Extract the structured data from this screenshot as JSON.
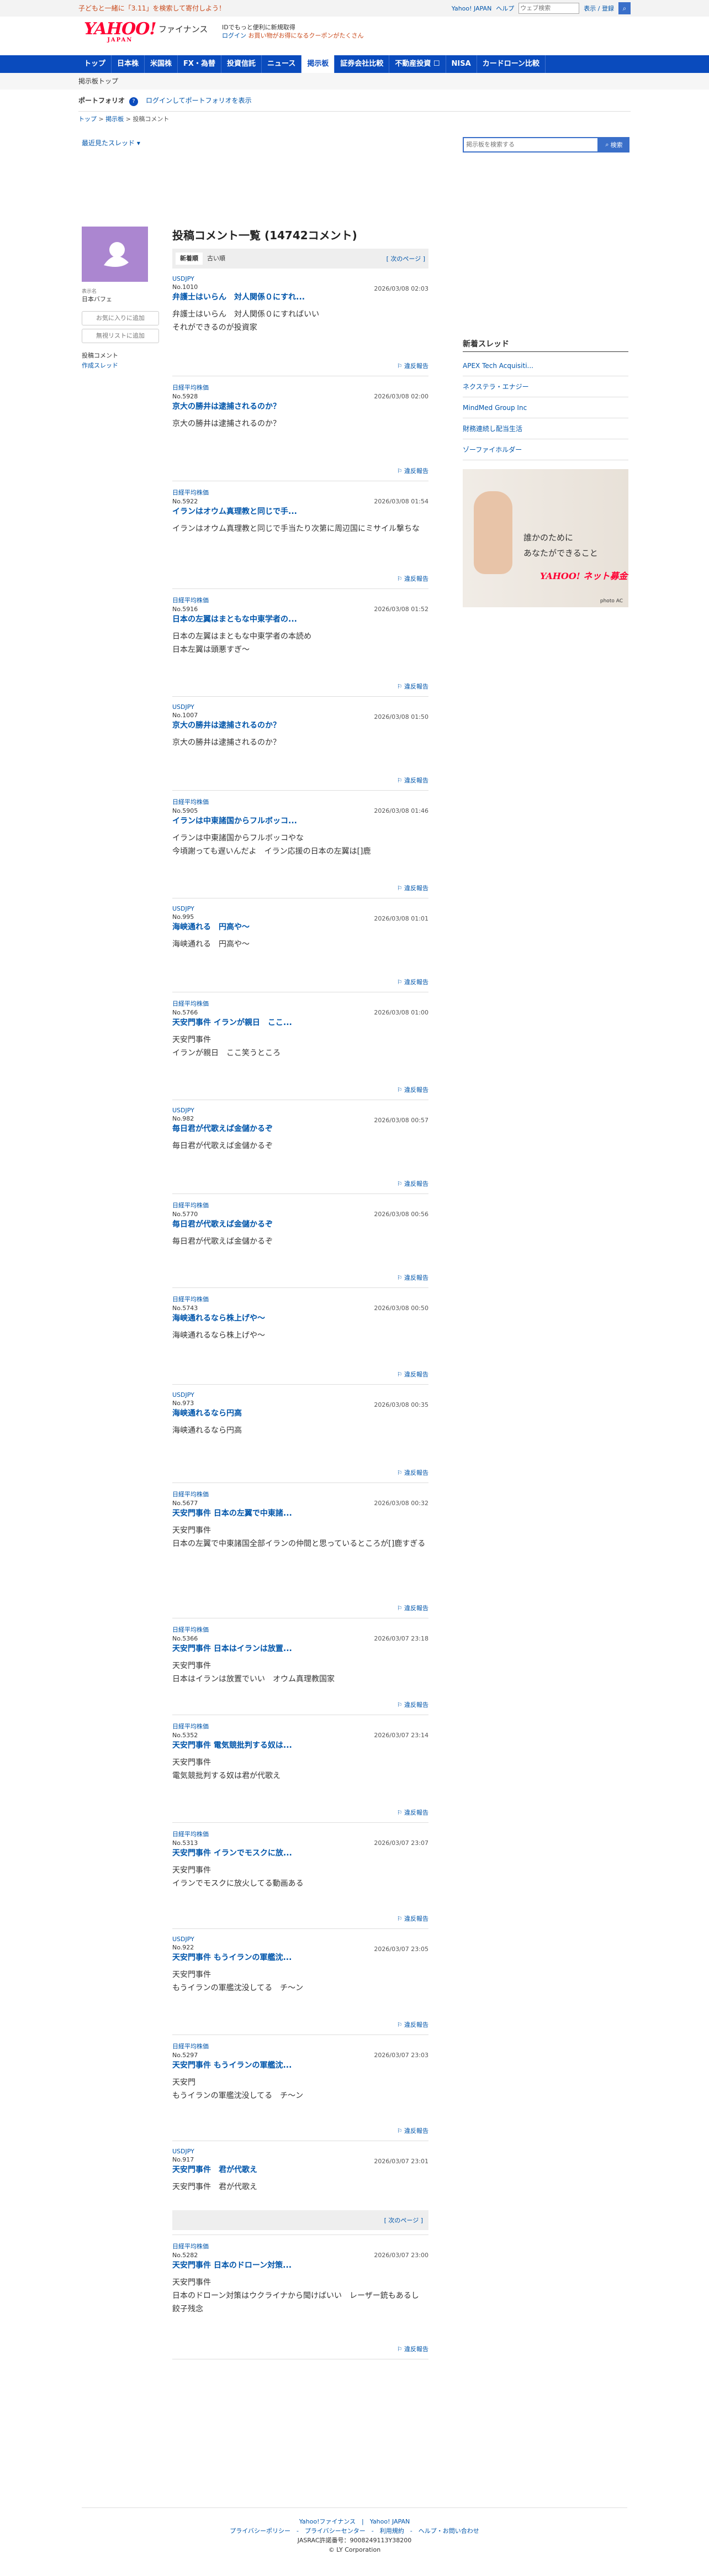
{
  "topbar": {
    "promo": "子どもと一緒に「3.11」を検索して寄付しよう！",
    "link_yahoo": "Yahoo! JAPAN",
    "link_help": "ヘルプ",
    "search_placeholder": "ウェブ検索",
    "misc": "表示 / 登録"
  },
  "header": {
    "logo_text": "YAHOO!",
    "logo_sub": "JAPAN",
    "service_name": "ファイナンス",
    "promo_line": "IDでもっと便利に新規取得",
    "login": "ログイン",
    "coupon": "お買い物がお得になるクーポンがたくさん"
  },
  "nav": {
    "items": [
      "トップ",
      "日本株",
      "米国株",
      "FX・為替",
      "投資信託",
      "ニュース",
      "掲示板",
      "証券会社比較",
      "不動産投資 ☐",
      "NISA",
      "カードローン比較"
    ],
    "active": "掲示板"
  },
  "subtitle": "掲示板トップ",
  "portfolio": {
    "label": "ポートフォリオ",
    "link": "ログインしてポートフォリオを表示"
  },
  "breadcrumb": [
    "トップ",
    "掲示板",
    "投稿コメント"
  ],
  "recent_threads": "最近見たスレッド",
  "board_search": {
    "placeholder": "掲示板を検索する",
    "button": "検索"
  },
  "profile": {
    "display_name_label": "表示名",
    "display_name": "日本バフェ",
    "fav_button": "お気に入りに追加",
    "block_button": "無視リストに追加",
    "link_posts": "投稿コメント",
    "link_threads": "作成スレッド"
  },
  "main": {
    "title": "投稿コメント一覧 (14742コメント)",
    "tab_new": "新着順",
    "tab_old": "古い順",
    "next_page": "[ 次のページ ]",
    "report_label": "違反報告",
    "posts": [
      {
        "user": "USDJPY",
        "no": "No.1010",
        "date": "2026/03/08 02:03",
        "title": "弁護士はいらん　対人関係０にすれ...",
        "body": "弁護士はいらん　対人関係０にすればいい\nそれができるのが投資家"
      },
      {
        "user": "日経平均株価",
        "no": "No.5928",
        "date": "2026/03/08 02:00",
        "title": "京大の勝井は逮捕されるのか？",
        "body": "京大の勝井は逮捕されるのか？"
      },
      {
        "user": "日経平均株価",
        "no": "No.5922",
        "date": "2026/03/08 01:54",
        "title": "イランはオウム真理教と同じで手...",
        "body": "イランはオウム真理教と同じで手当たり次第に周辺国にミサイル撃ちな"
      },
      {
        "user": "日経平均株価",
        "no": "No.5916",
        "date": "2026/03/08 01:52",
        "title": "日本の左翼はまともな中東学者の...",
        "body": "日本の左翼はまともな中東学者の本読め\n日本左翼は頭悪すぎ〜"
      },
      {
        "user": "USDJPY",
        "no": "No.1007",
        "date": "2026/03/08 01:50",
        "title": "京大の勝井は逮捕されるのか？",
        "body": "京大の勝井は逮捕されるのか？"
      },
      {
        "user": "日経平均株価",
        "no": "No.5905",
        "date": "2026/03/08 01:46",
        "title": "イランは中東諸国からフルボッコ...",
        "body": "イランは中東諸国からフルボッコやな\n今頃謝っても遅いんだよ　イラン応援の日本の左翼は[]鹿"
      },
      {
        "user": "USDJPY",
        "no": "No.995",
        "date": "2026/03/08 01:01",
        "title": "海峡通れる　円高や〜",
        "body": "海峡通れる　円高や〜"
      },
      {
        "user": "日経平均株価",
        "no": "No.5766",
        "date": "2026/03/08 01:00",
        "title": "天安門事件 イランが親日　ここ...",
        "body": "天安門事件\nイランが親日　ここ笑うところ"
      },
      {
        "user": "USDJPY",
        "no": "No.982",
        "date": "2026/03/08 00:57",
        "title": "毎日君が代歌えば金儲かるぞ",
        "body": "毎日君が代歌えば金儲かるぞ"
      },
      {
        "user": "日経平均株価",
        "no": "No.5770",
        "date": "2026/03/08 00:56",
        "title": "毎日君が代歌えば金儲かるぞ",
        "body": "毎日君が代歌えば金儲かるぞ"
      },
      {
        "user": "日経平均株価",
        "no": "No.5743",
        "date": "2026/03/08 00:50",
        "title": "海峡通れるなら株上げや〜",
        "body": "海峡通れるなら株上げや〜"
      },
      {
        "user": "USDJPY",
        "no": "No.973",
        "date": "2026/03/08 00:35",
        "title": "海峡通れるなら円高",
        "body": "海峡通れるなら円高"
      },
      {
        "user": "日経平均株価",
        "no": "No.5677",
        "date": "2026/03/08 00:32",
        "title": "天安門事件 日本の左翼で中東諸...",
        "body": "天安門事件\n日本の左翼で中東諸国全部イランの仲間と思っているところが[]鹿すぎる"
      },
      {
        "user": "日経平均株価",
        "no": "No.5366",
        "date": "2026/03/07 23:18",
        "title": "天安門事件 日本はイランは放置...",
        "body": "天安門事件\n日本はイランは放置でいい　オウム真理教国家"
      },
      {
        "user": "日経平均株価",
        "no": "No.5352",
        "date": "2026/03/07 23:14",
        "title": "天安門事件 電気競批判する奴は...",
        "body": "天安門事件\n電気競批判する奴は君が代歌え"
      },
      {
        "user": "日経平均株価",
        "no": "No.5313",
        "date": "2026/03/07 23:07",
        "title": "天安門事件 イランでモスクに放...",
        "body": "天安門事件\nイランでモスクに放火してる動画ある"
      },
      {
        "user": "USDJPY",
        "no": "No.922",
        "date": "2026/03/07 23:05",
        "title": "天安門事件 もうイランの軍艦沈...",
        "body": "天安門事件\nもうイランの軍艦沈没してる　チ〜ン"
      },
      {
        "user": "日経平均株価",
        "no": "No.5297",
        "date": "2026/03/07 23:03",
        "title": "天安門事件 もうイランの軍艦沈...",
        "body": "天安門\nもうイランの軍艦沈没してる　チ〜ン"
      },
      {
        "user": "USDJPY",
        "no": "No.917",
        "date": "2026/03/07 23:01",
        "title": "天安門事件　君が代歌え",
        "body": "天安門事件　君が代歌え"
      },
      {
        "user": "日経平均株価",
        "no": "No.5282",
        "date": "2026/03/07 23:00",
        "title": "天安門事件 日本のドローン対策...",
        "body": "天安門事件\n日本のドローン対策はウクライナから聞けばいい　レーザー銃もあるし　餃子残念"
      }
    ]
  },
  "right": {
    "heading": "新着スレッド",
    "threads": [
      "APEX Tech Acquisiti...",
      "ネクステラ・エナジー",
      "MindMed Group Inc",
      "財務連続し配当生活",
      "ゾーファイホルダー"
    ],
    "ad_text_1": "誰かのために",
    "ad_text_2": "あなたができること",
    "ad_brand": "YAHOO! ネット募金",
    "ad_credit": "photo AC"
  },
  "footer": {
    "links_1": "Yahoo!ファイナンス　|　Yahoo! JAPAN",
    "links_2": "プライバシーポリシー　-　プライバシーセンター　-　利用規約　-　ヘルプ・お問い合わせ",
    "jasrac": "JASRAC許諾番号：9008249113Y38200",
    "copyright": "© LY Corporation"
  }
}
